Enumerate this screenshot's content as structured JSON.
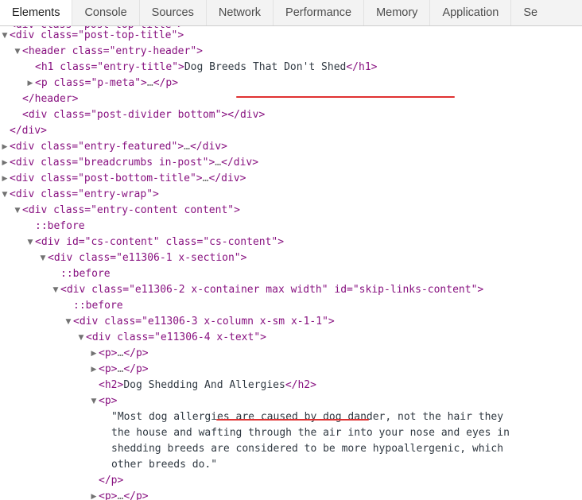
{
  "devtools": {
    "tabs": [
      {
        "label": "Elements",
        "active": true
      },
      {
        "label": "Console",
        "active": false
      },
      {
        "label": "Sources",
        "active": false
      },
      {
        "label": "Network",
        "active": false
      },
      {
        "label": "Performance",
        "active": false
      },
      {
        "label": "Memory",
        "active": false
      },
      {
        "label": "Application",
        "active": false
      },
      {
        "label": "Se",
        "active": false
      }
    ]
  },
  "dom_rows": [
    {
      "indent": 0,
      "twisty": "down",
      "text": "<div class=\"post-top-title\">"
    },
    {
      "indent": 1,
      "twisty": "down",
      "text": "<header class=\"entry-header\">"
    },
    {
      "indent": 2,
      "twisty": "",
      "text": "<h1 class=\"entry-title\">Dog Breeds That Don't Shed</h1>"
    },
    {
      "indent": 2,
      "twisty": "right",
      "text": "<p class=\"p-meta\">…</p>"
    },
    {
      "indent": 1,
      "twisty": "",
      "text": "</header>"
    },
    {
      "indent": 1,
      "twisty": "",
      "text": "<div class=\"post-divider bottom\"></div>"
    },
    {
      "indent": 0,
      "twisty": "",
      "text": "</div>"
    },
    {
      "indent": 0,
      "twisty": "right",
      "text": "<div class=\"entry-featured\">…</div>"
    },
    {
      "indent": 0,
      "twisty": "right",
      "text": "<div class=\"breadcrumbs in-post\">…</div>"
    },
    {
      "indent": 0,
      "twisty": "right",
      "text": "<div class=\"post-bottom-title\">…</div>"
    },
    {
      "indent": 0,
      "twisty": "down",
      "text": "<div class=\"entry-wrap\">"
    },
    {
      "indent": 1,
      "twisty": "down",
      "text": "<div class=\"entry-content content\">"
    },
    {
      "indent": 2,
      "twisty": "",
      "text": "::before"
    },
    {
      "indent": 2,
      "twisty": "down",
      "text": "<div id=\"cs-content\" class=\"cs-content\">"
    },
    {
      "indent": 3,
      "twisty": "down",
      "text": "<div class=\"e11306-1 x-section\">"
    },
    {
      "indent": 4,
      "twisty": "",
      "text": "::before"
    },
    {
      "indent": 4,
      "twisty": "down",
      "text": "<div class=\"e11306-2 x-container max width\" id=\"skip-links-content\">"
    },
    {
      "indent": 5,
      "twisty": "",
      "text": "::before"
    },
    {
      "indent": 5,
      "twisty": "down",
      "text": "<div class=\"e11306-3 x-column x-sm x-1-1\">"
    },
    {
      "indent": 6,
      "twisty": "down",
      "text": "<div class=\"e11306-4 x-text\">"
    },
    {
      "indent": 7,
      "twisty": "right",
      "text": "<p>…</p>"
    },
    {
      "indent": 7,
      "twisty": "right",
      "text": "<p>…</p>"
    },
    {
      "indent": 7,
      "twisty": "",
      "text": "<h2>Dog Shedding And Allergies</h2>"
    },
    {
      "indent": 7,
      "twisty": "down",
      "text": "<p>"
    },
    {
      "indent": 8,
      "twisty": "",
      "text": "\"Most dog allergies are caused by dog dander, not the hair they"
    },
    {
      "indent": 8,
      "twisty": "",
      "text": "the house and wafting through the air into your nose and eyes in"
    },
    {
      "indent": 8,
      "twisty": "",
      "text": "shedding breeds are considered to be more hypoallergenic, which"
    },
    {
      "indent": 8,
      "twisty": "",
      "text": "other breeds do.\""
    },
    {
      "indent": 7,
      "twisty": "",
      "text": "</p>"
    },
    {
      "indent": 7,
      "twisty": "right",
      "text": "<p>…</p>"
    }
  ],
  "annotations": {
    "underline_entry_title": "Dog Breeds That Don't Shed",
    "underline_h2": "Dog Shedding And Allergies",
    "underline_color": "#e03131"
  }
}
